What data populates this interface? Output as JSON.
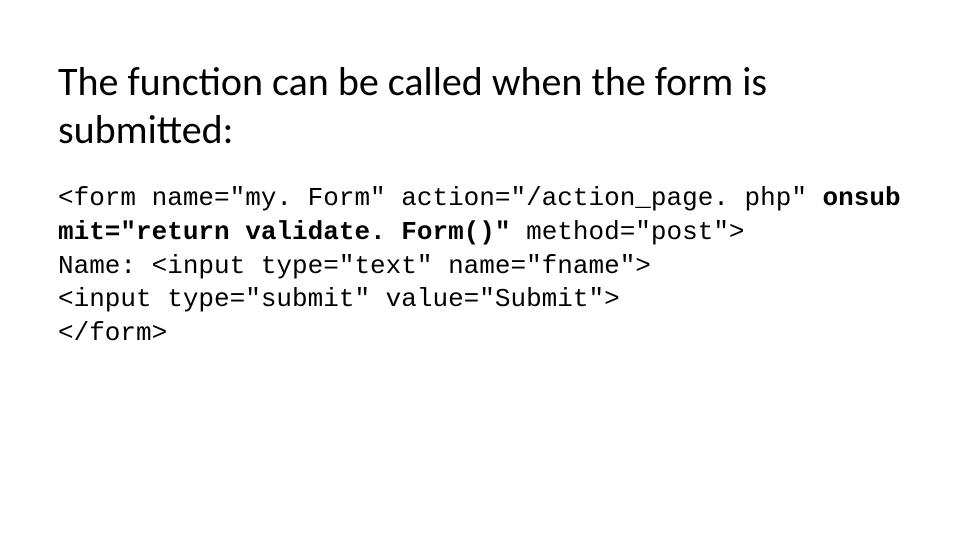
{
  "heading": "The function can be called when the form is submitted:",
  "code": {
    "plain_segment_1": "<form name=\"my. Form\" action=\"/action_page. php\" ",
    "bold_segment": "onsubmit=\"return validate. Form()\"",
    "plain_segment_2": " method=\"post\">",
    "line3": "Name: <input type=\"text\" name=\"fname\">",
    "line4": "<input type=\"submit\" value=\"Submit\">",
    "line5": "</form>"
  }
}
